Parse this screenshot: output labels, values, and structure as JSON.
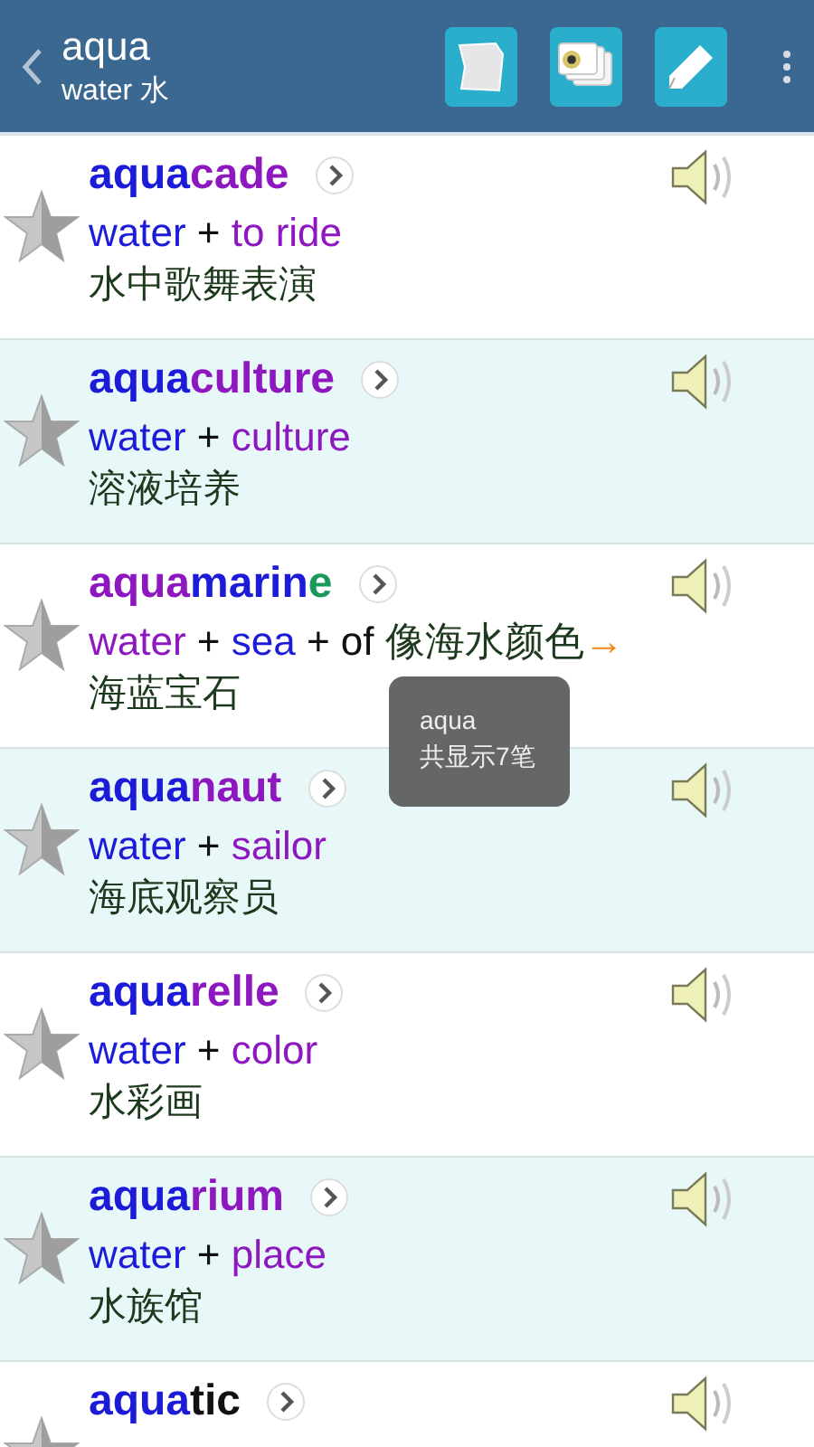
{
  "header": {
    "title": "aqua",
    "subtitle": "water 水"
  },
  "rows": [
    {
      "word": [
        {
          "text": "aqua",
          "color": "#1c1cd8"
        },
        {
          "text": "cade",
          "color": "#8e18c0"
        }
      ],
      "etymology": [
        {
          "text": "water",
          "color": "#1c1cd8"
        },
        {
          "text": " + ",
          "color": "#111111"
        },
        {
          "text": "to ride",
          "color": "#8e18c0"
        }
      ],
      "meaning": "水中歌舞表演"
    },
    {
      "word": [
        {
          "text": "aqua",
          "color": "#1c1cd8"
        },
        {
          "text": "culture",
          "color": "#8e18c0"
        }
      ],
      "etymology": [
        {
          "text": "water",
          "color": "#1c1cd8"
        },
        {
          "text": " + ",
          "color": "#111111"
        },
        {
          "text": "culture",
          "color": "#8e18c0"
        }
      ],
      "meaning": "溶液培养"
    },
    {
      "word": [
        {
          "text": "aqua",
          "color": "#8e18c0"
        },
        {
          "text": "marin",
          "color": "#1c1cd8"
        },
        {
          "text": "e",
          "color": "#1a9a5a"
        }
      ],
      "etymology": [
        {
          "text": "water",
          "color": "#8e18c0"
        },
        {
          "text": " + ",
          "color": "#111111"
        },
        {
          "text": "sea",
          "color": "#1c1cd8"
        },
        {
          "text": " + of ",
          "color": "#111111"
        },
        {
          "text": "像海水颜色",
          "color": "#1e3a1e"
        },
        {
          "text": "→",
          "color": "#f08a1c"
        }
      ],
      "meaning": "海蓝宝石"
    },
    {
      "word": [
        {
          "text": "aqua",
          "color": "#1c1cd8"
        },
        {
          "text": "naut",
          "color": "#8e18c0"
        }
      ],
      "etymology": [
        {
          "text": "water",
          "color": "#1c1cd8"
        },
        {
          "text": " + ",
          "color": "#111111"
        },
        {
          "text": "sailor",
          "color": "#8e18c0"
        }
      ],
      "meaning": "海底观察员"
    },
    {
      "word": [
        {
          "text": "aqua",
          "color": "#1c1cd8"
        },
        {
          "text": "relle",
          "color": "#8e18c0"
        }
      ],
      "etymology": [
        {
          "text": "water",
          "color": "#1c1cd8"
        },
        {
          "text": " + ",
          "color": "#111111"
        },
        {
          "text": "color",
          "color": "#8e18c0"
        }
      ],
      "meaning": "水彩画"
    },
    {
      "word": [
        {
          "text": "aqua",
          "color": "#1c1cd8"
        },
        {
          "text": "rium",
          "color": "#8e18c0"
        }
      ],
      "etymology": [
        {
          "text": "water",
          "color": "#1c1cd8"
        },
        {
          "text": " + ",
          "color": "#111111"
        },
        {
          "text": "place",
          "color": "#8e18c0"
        }
      ],
      "meaning": "水族馆"
    },
    {
      "word": [
        {
          "text": "aqua",
          "color": "#1c1cd8"
        },
        {
          "text": "tic",
          "color": "#111111"
        }
      ]
    }
  ],
  "toast": {
    "title": "aqua",
    "message": "共显示7笔"
  }
}
